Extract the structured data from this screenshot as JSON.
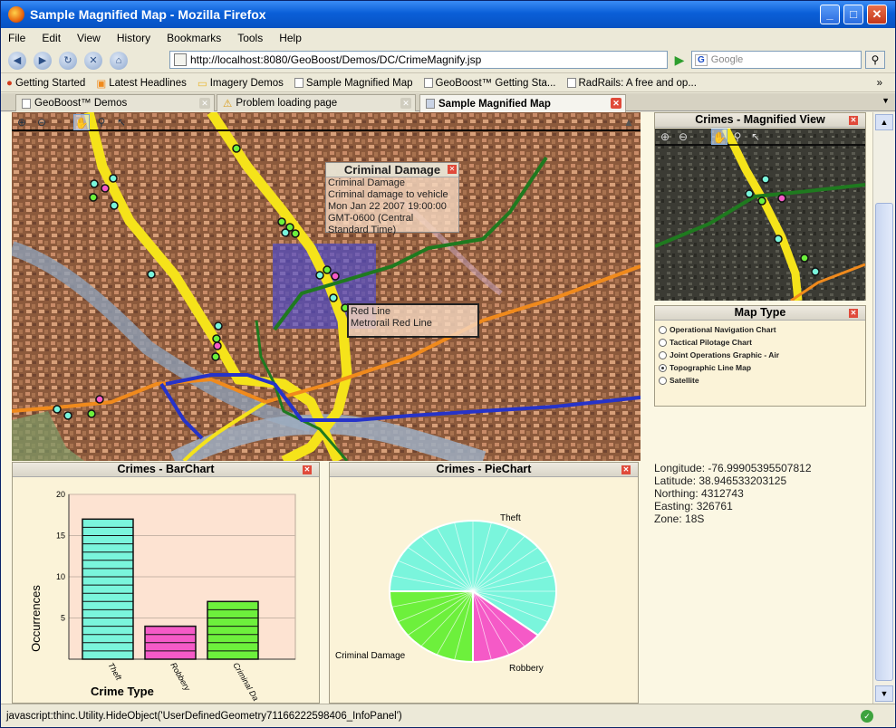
{
  "window": {
    "title": "Sample Magnified Map - Mozilla Firefox"
  },
  "menu": [
    "File",
    "Edit",
    "View",
    "History",
    "Bookmarks",
    "Tools",
    "Help"
  ],
  "url": "http://localhost:8080/GeoBoost/Demos/DC/CrimeMagnify.jsp",
  "search_placeholder": "Google",
  "bookmarks": [
    "Getting Started",
    "Latest Headlines",
    "Imagery Demos",
    "Sample Magnified Map",
    "GeoBoost™ Getting Sta...",
    "RadRails: A free and op..."
  ],
  "tabs": [
    {
      "label": "GeoBoost™ Demos",
      "active": false
    },
    {
      "label": "Problem loading page",
      "active": false
    },
    {
      "label": "Sample Magnified Map",
      "active": true
    }
  ],
  "info_panels": {
    "criminal_damage": {
      "title": "Criminal Damage",
      "lines": [
        "Criminal Damage",
        "Criminal damage to vehicle",
        "Mon Jan 22 2007 19:00:00",
        "GMT-0600 (Central",
        "Standard Time)"
      ]
    },
    "red_line": {
      "lines": [
        "Red Line",
        "Metrorail Red Line"
      ]
    }
  },
  "magnified": {
    "title": "Crimes - Magnified View"
  },
  "map_type": {
    "title": "Map Type",
    "options": [
      "Operational Navigation Chart",
      "Tactical Pilotage Chart",
      "Joint Operations Graphic - Air",
      "Topographic Line Map",
      "Satellite"
    ],
    "selected": 3
  },
  "coords": {
    "longitude": "Longitude: -76.99905395507812",
    "latitude": "Latitude: 38.946533203125",
    "northing": "Northing: 4312743",
    "easting": "Easting: 326761",
    "zone": "Zone: 18S"
  },
  "status": "javascript:thinc.Utility.HideObject('UserDefinedGeometry71166222598406_InfoPanel')",
  "chart_data": [
    {
      "type": "bar",
      "title": "Crimes - BarChart",
      "categories": [
        "Theft",
        "Robbery",
        "Criminal Da"
      ],
      "values": [
        17,
        4,
        7
      ],
      "colors": [
        "#7af5dc",
        "#f55ac7",
        "#6df03c"
      ],
      "xlabel": "Crime Type",
      "ylabel": "Occurrences",
      "ylim": [
        0,
        20
      ],
      "yticks": [
        "5",
        "10",
        "15",
        "20"
      ]
    },
    {
      "type": "pie",
      "title": "Crimes - PieChart",
      "categories": [
        "Theft",
        "Robbery",
        "Criminal Damage"
      ],
      "values": [
        17,
        4,
        7
      ],
      "colors": [
        "#7af5dc",
        "#f55ac7",
        "#6df03c"
      ]
    }
  ],
  "colors": {
    "theft": "#7af5dc",
    "robbery": "#f55ac7",
    "damage": "#6df03c",
    "red_line": "#f5e31a",
    "orange_line": "#f08a1c",
    "blue_line": "#2633c9",
    "green_line": "#1f7a1f"
  }
}
